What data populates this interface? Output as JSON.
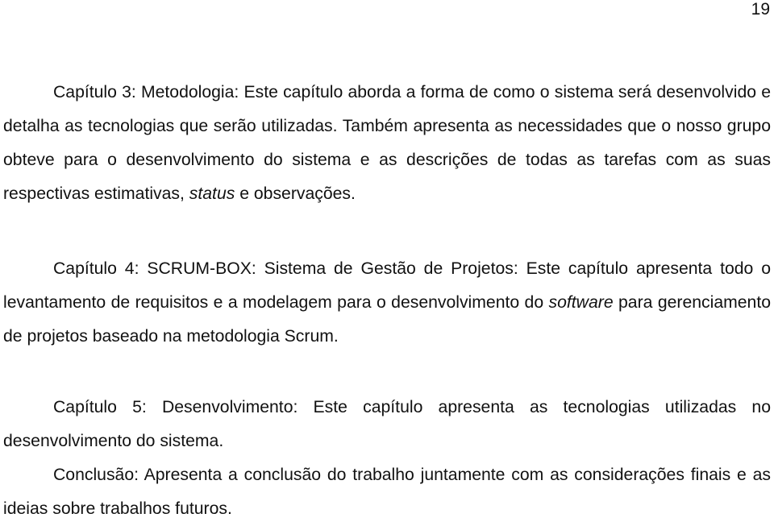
{
  "page": {
    "number": "19"
  },
  "paragraphs": [
    {
      "before": "Capítulo 3: Metodologia: Este capítulo aborda a forma de como o sistema será desenvolvido e detalha as tecnologias que serão utilizadas. Também apresenta as necessidades que o nosso grupo obteve para o desenvolvimento do sistema e as descrições de todas as tarefas com as suas respectivas estimativas, ",
      "italic": "status",
      "after": " e observações."
    },
    {
      "before": "Capítulo 4: SCRUM-BOX: Sistema de Gestão de Projetos: Este capítulo apresenta todo o levantamento de requisitos e a modelagem para o desenvolvimento do ",
      "italic": "software",
      "after": " para gerenciamento de projetos baseado na metodologia Scrum."
    },
    {
      "before": "Capítulo 5: Desenvolvimento: Este capítulo apresenta as tecnologias utilizadas no desenvolvimento do sistema.",
      "italic": "",
      "after": ""
    },
    {
      "before": "Conclusão: Apresenta a conclusão do trabalho juntamente com as considerações finais e as ideias sobre trabalhos futuros.",
      "italic": "",
      "after": ""
    }
  ]
}
